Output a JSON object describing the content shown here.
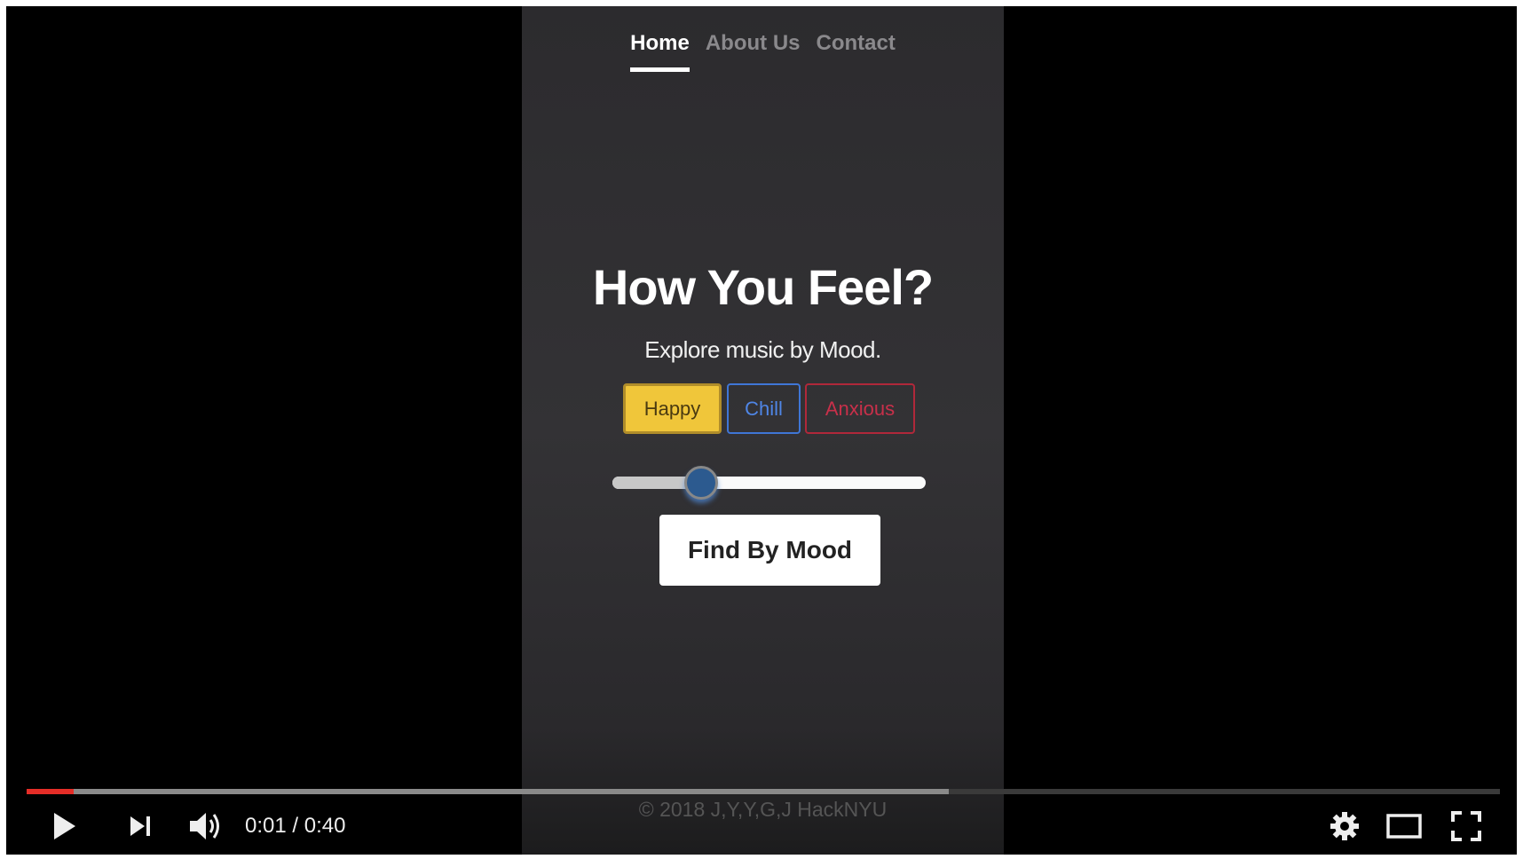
{
  "app": {
    "nav": [
      {
        "label": "Home",
        "active": true
      },
      {
        "label": "About Us",
        "active": false
      },
      {
        "label": "Contact",
        "active": false
      }
    ],
    "title": "How You Feel?",
    "subtitle": "Explore music by Mood.",
    "moods": [
      {
        "label": "Happy",
        "color": "#f0c63a",
        "selected": true
      },
      {
        "label": "Chill",
        "color": "#3f76d6"
      },
      {
        "label": "Anxious",
        "color": "#b0283a"
      }
    ],
    "slider_percent": 28,
    "find_button": "Find By Mood",
    "footer": "© 2018 J,Y,Y,G,J HackNYU"
  },
  "player": {
    "current_time": "0:01",
    "separator": "/",
    "duration": "0:40",
    "played_percent": 3.2,
    "buffered_percent": 62.6,
    "progress_color": "#e52d27",
    "icons": [
      "play-icon",
      "next-icon",
      "volume-icon",
      "settings-icon",
      "theater-mode-icon",
      "fullscreen-icon"
    ]
  }
}
